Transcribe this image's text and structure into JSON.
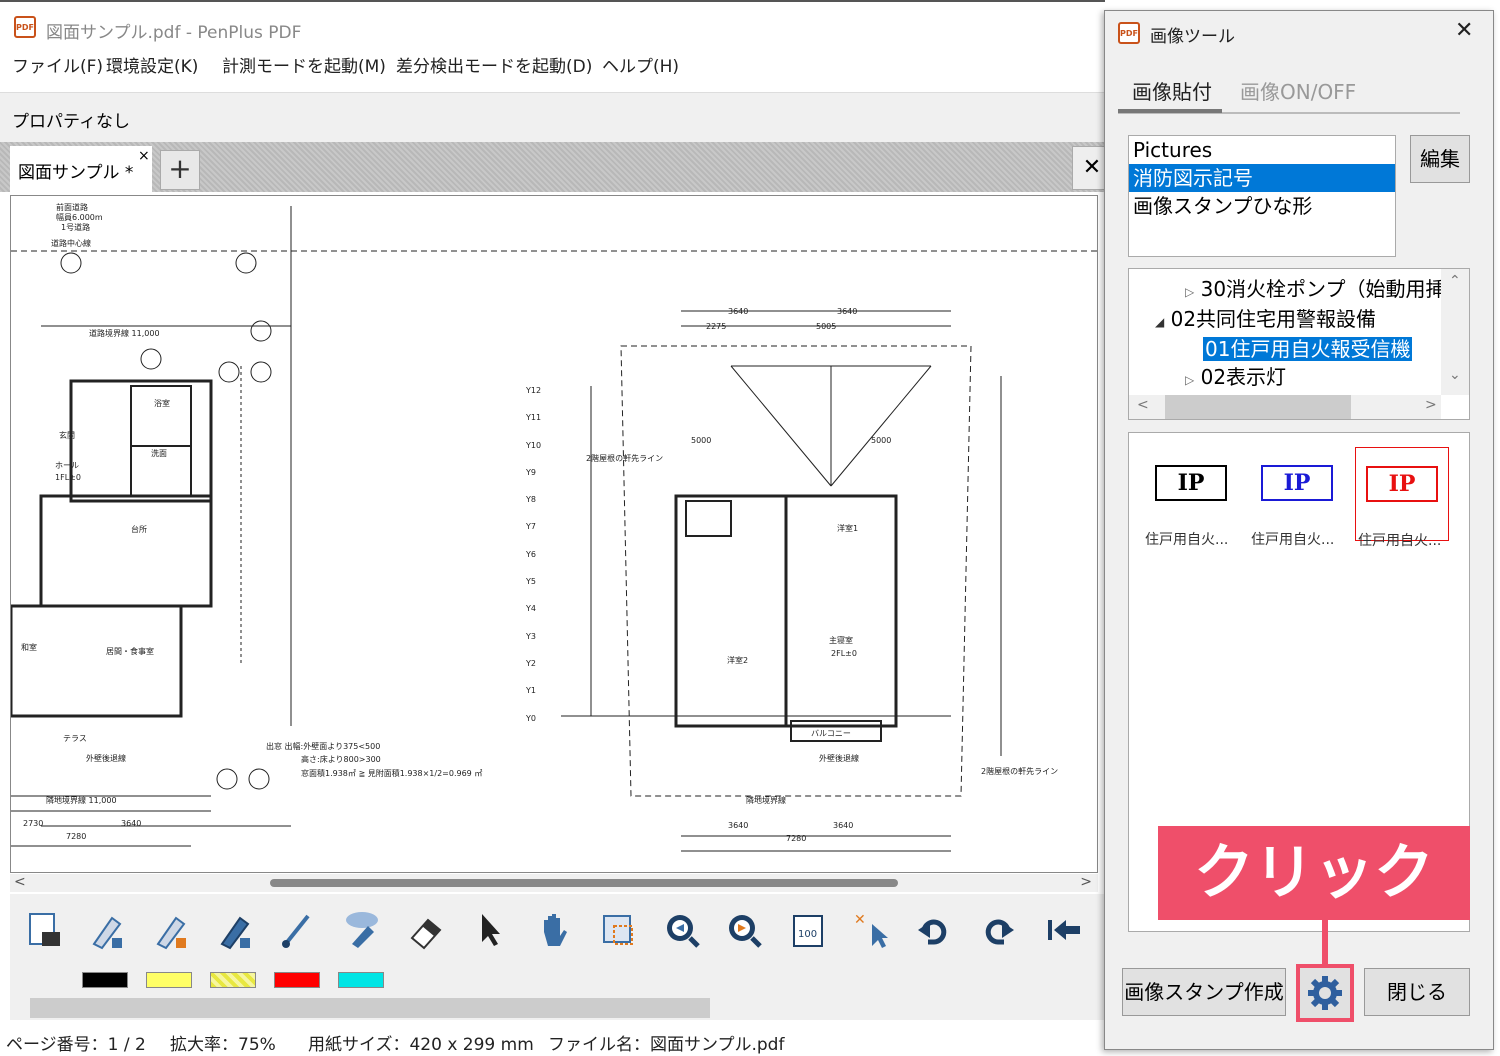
{
  "window": {
    "title": "図面サンプル.pdf - PenPlus PDF",
    "app_icon": "pdf-icon"
  },
  "menu": [
    "ファイル(F)",
    "環境設定(K)",
    "計測モードを起動(M)",
    "差分検出モードを起動(D)",
    "ヘルプ(H)"
  ],
  "property_bar": "プロパティなし",
  "doc_tab": {
    "label": "図面サンプル *",
    "close": "×",
    "add": "+",
    "close_all": "✕"
  },
  "toolbar": {
    "tools": [
      "text-box-icon",
      "marker-1-icon",
      "marker-2-icon",
      "highlighter-1-icon",
      "brush-icon",
      "stamp-text-icon",
      "eraser-icon",
      "select-arrow-icon",
      "hand-icon",
      "area-select-icon",
      "zoom-out-icon",
      "zoom-in-icon",
      "fit-page-icon",
      "delete-stamp-icon",
      "undo-icon",
      "redo-icon",
      "first-page-icon"
    ],
    "colors": [
      "#000000",
      "#ffff66",
      "#e8e840",
      "#ff0000",
      "#00e5e5"
    ]
  },
  "status": {
    "page": "ページ番号：1 / 2",
    "zoom": "拡大率：75%",
    "paper": "用紙サイズ：420 x 299 mm",
    "file": "ファイル名：図面サンプル.pdf"
  },
  "panel": {
    "title": "画像ツール",
    "close": "✕",
    "tabs": [
      "画像貼付",
      "画像ON/OFF"
    ],
    "folders": [
      "Pictures",
      "消防図示記号",
      "画像スタンプひな形"
    ],
    "selected_folder": "消防図示記号",
    "edit_button": "編集",
    "tree": [
      {
        "expander": "▷",
        "text": "30消火栓ポンプ（始動用挿"
      },
      {
        "expander": "◢",
        "text": "02共同住宅用警報設備"
      },
      {
        "expander": "",
        "text": "01住戸用自火報受信機"
      },
      {
        "expander": "▷",
        "text": "02表示灯"
      }
    ],
    "stamps": [
      {
        "text": "IP",
        "color": "#000000",
        "label": "住戸用自火..."
      },
      {
        "text": "IP",
        "color": "#1a1ad6",
        "label": "住戸用自火..."
      },
      {
        "text": "IP",
        "color": "#e81010",
        "label": "住戸用自火..."
      }
    ],
    "callout": "クリック",
    "buttons": {
      "create": "画像スタンプ作成",
      "close": "閉じる"
    }
  },
  "drawing": {
    "left_labels": [
      "前面道路",
      "幅員6.000m",
      "1号道路",
      "道路中心線",
      "玄関",
      "ホール",
      "1FL±0",
      "台所",
      "居間・食事室",
      "浴室",
      "洗面",
      "和室",
      "テラス",
      "外壁後退線",
      "隣地境界線 11,000",
      "道路境界線 11,000",
      "2730",
      "7280",
      "3640"
    ],
    "right_labels": [
      "3640",
      "2275",
      "5005",
      "5000",
      "洋室1",
      "洋室2",
      "主寝室",
      "2FL±0",
      "バルコニー",
      "隣地境界線",
      "外壁後退線",
      "Y12",
      "Y11",
      "Y10",
      "Y9",
      "Y8",
      "Y7",
      "Y6",
      "Y5",
      "Y4",
      "Y3",
      "Y2",
      "Y1",
      "Y0",
      "2階屋根の軒先ライン"
    ],
    "notes": [
      "出窓 出幅:外壁面より375<500",
      "高さ:床より800>300",
      "窓面積1.938㎡ ≧ 見附面積1.938×1/2=0.969 ㎡"
    ]
  }
}
